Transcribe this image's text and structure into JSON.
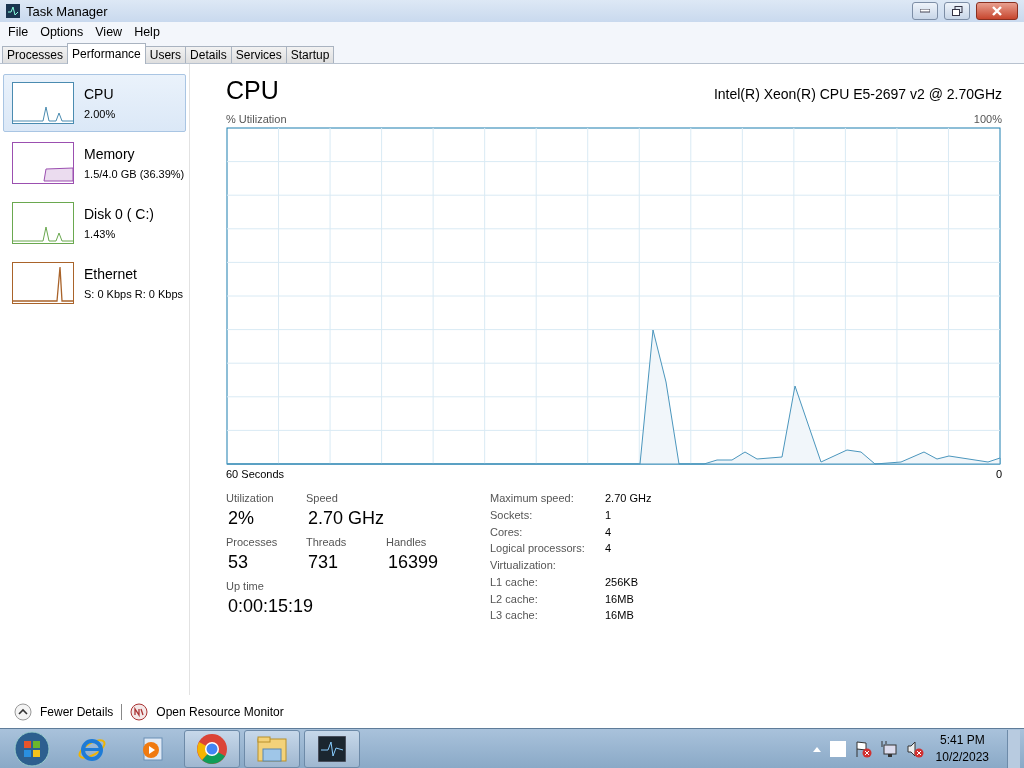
{
  "window": {
    "title": "Task Manager"
  },
  "menu": [
    "File",
    "Options",
    "View",
    "Help"
  ],
  "tabs": [
    {
      "label": "Processes",
      "selected": false
    },
    {
      "label": "Performance",
      "selected": true
    },
    {
      "label": "Users",
      "selected": false
    },
    {
      "label": "Details",
      "selected": false
    },
    {
      "label": "Services",
      "selected": false
    },
    {
      "label": "Startup",
      "selected": false
    }
  ],
  "sidebar": {
    "items": [
      {
        "name": "CPU",
        "value": "2.00%",
        "color": "#4a8bb0",
        "kind": "spikes",
        "selected": true
      },
      {
        "name": "Memory",
        "value": "1.5/4.0 GB (36.39%)",
        "color": "#9b4fb0",
        "kind": "area",
        "selected": false
      },
      {
        "name": "Disk 0 ( C:)",
        "value": "1.43%",
        "color": "#6aa84f",
        "kind": "spikes",
        "selected": false
      },
      {
        "name": "Ethernet",
        "value": "S: 0 Kbps R: 0 Kbps",
        "color": "#a9632a",
        "kind": "spike",
        "selected": false
      }
    ]
  },
  "panel": {
    "title": "CPU",
    "model": "Intel(R) Xeon(R) CPU E5-2697 v2 @ 2.70GHz",
    "graph_label": "% Utilization",
    "graph_max": "100%",
    "time_label": "60 Seconds",
    "time_end": "0",
    "stats": [
      [
        {
          "label": "Utilization",
          "value": "2%"
        },
        {
          "label": "Speed",
          "value": "2.70 GHz"
        }
      ],
      [
        {
          "label": "Processes",
          "value": "53"
        },
        {
          "label": "Threads",
          "value": "731"
        },
        {
          "label": "Handles",
          "value": "16399"
        }
      ],
      [
        {
          "label": "Up time",
          "value": "0:00:15:19"
        }
      ]
    ],
    "details": [
      {
        "label": "Maximum speed:",
        "value": "2.70 GHz"
      },
      {
        "label": "Sockets:",
        "value": "1"
      },
      {
        "label": "Cores:",
        "value": "4"
      },
      {
        "label": "Logical processors:",
        "value": "4"
      },
      {
        "label": "Virtualization:"
      },
      {
        "label": "L1 cache:",
        "value": "256KB"
      },
      {
        "label": "L2 cache:",
        "value": "16MB"
      },
      {
        "label": "L3 cache:",
        "value": "16MB"
      }
    ]
  },
  "footer": {
    "fewer_details": "Fewer Details",
    "resource_monitor": "Open Resource Monitor"
  },
  "taskbar": {
    "time": "5:41 PM",
    "date": "10/2/2023"
  }
}
